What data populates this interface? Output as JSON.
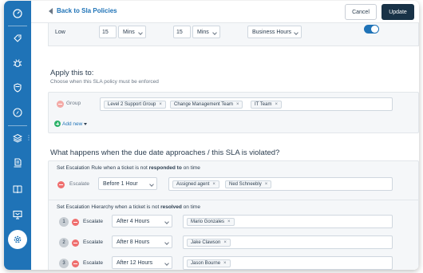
{
  "header": {
    "back_label": "Back to Sla Policies",
    "cancel_label": "Cancel",
    "update_label": "Update"
  },
  "sidebar": {
    "icons": [
      "gauge-icon",
      "tag-icon",
      "bug-icon",
      "shield-icon",
      "compass-icon",
      "layers-icon",
      "document-icon",
      "book-icon",
      "monitor-icon",
      "gear-icon"
    ]
  },
  "priority_row": {
    "priority": "Low",
    "respond_value": "15",
    "respond_unit": "Mins",
    "resolve_value": "15",
    "resolve_unit": "Mins",
    "hours_type": "Business Hours",
    "escalation_enabled": true
  },
  "apply": {
    "title": "Apply this to:",
    "subtitle": "Choose when this SLA policy must be enforced",
    "condition_label": "Group",
    "groups": [
      "Level 2 Support Group",
      "Change Management Team",
      "IT Team"
    ],
    "add_new_label": "Add new"
  },
  "violation": {
    "title": "What happens when the due date approaches / this SLA is violated?",
    "response_rule": {
      "prefix": "Set Escalation Rule when a ticket is not ",
      "emphasis": "responded to",
      "suffix": " on time",
      "escalate_label": "Escalate",
      "timing": "Before 1 Hour",
      "agents": [
        "Assigned agent",
        "Ned Schneebly"
      ]
    },
    "resolution_rule": {
      "prefix": "Set Escalation Hierarchy when a ticket is not ",
      "emphasis": "resolved",
      "suffix": " on time",
      "levels": [
        {
          "number": "1",
          "escalate_label": "Escalate",
          "timing": "After 4 Hours",
          "agent": "Mario Gonzales"
        },
        {
          "number": "2",
          "escalate_label": "Escalate",
          "timing": "After 8 Hours",
          "agent": "Jake Clawson"
        },
        {
          "number": "3",
          "escalate_label": "Escalate",
          "timing": "After 12 Hours",
          "agent": "Jason Bourne"
        }
      ]
    }
  },
  "colors": {
    "sidebar": "#1f73b7",
    "primary_button": "#183247",
    "toggle_on": "#1f73b7",
    "remove": "#ef6f6f",
    "add": "#2fb36b"
  }
}
